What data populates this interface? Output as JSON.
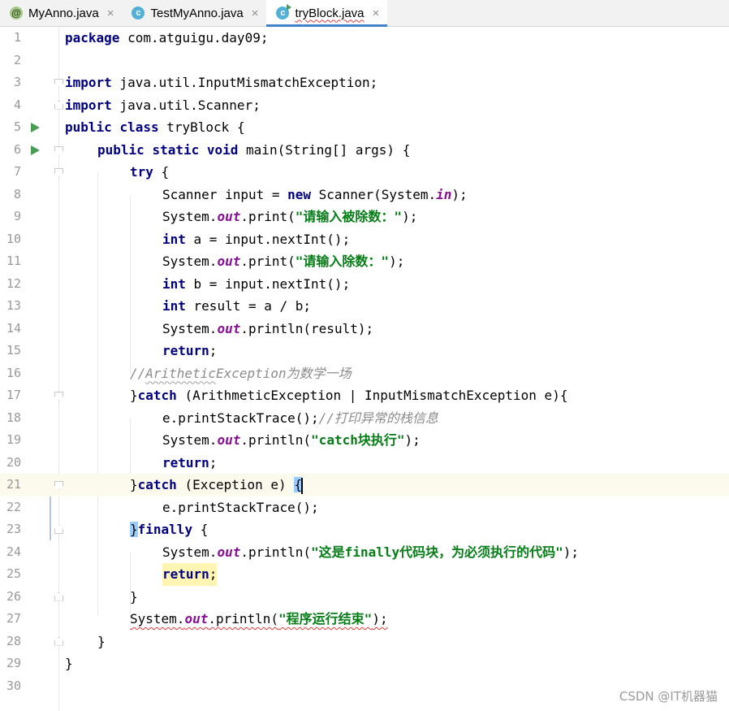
{
  "tabs": [
    {
      "label": "MyAnno.java",
      "icon": "annotation-file-icon",
      "close": "×"
    },
    {
      "label": "TestMyAnno.java",
      "icon": "class-file-icon",
      "close": "×"
    },
    {
      "label": "tryBlock.java",
      "icon": "runnable-class-icon",
      "close": "×"
    }
  ],
  "line_numbers": [
    "1",
    "2",
    "3",
    "4",
    "5",
    "6",
    "7",
    "8",
    "9",
    "10",
    "11",
    "12",
    "13",
    "14",
    "15",
    "16",
    "17",
    "18",
    "19",
    "20",
    "21",
    "22",
    "23",
    "24",
    "25",
    "26",
    "27",
    "28",
    "29",
    "30"
  ],
  "code": {
    "l1": {
      "kw": "package",
      "rest": " com.atguigu.day09;"
    },
    "l3": {
      "kw": "import",
      "rest": " java.util.InputMismatchException;"
    },
    "l4": {
      "kw": "import",
      "rest": " java.util.Scanner;"
    },
    "l5": {
      "kw1": "public",
      "kw2": "class",
      "rest": " tryBlock {"
    },
    "l6": {
      "kw1": "public",
      "kw2": "static",
      "kw3": "void",
      "rest": " main(String[] args) {"
    },
    "l7": {
      "kw": "try",
      "rest": " {"
    },
    "l8": {
      "a": "Scanner input = ",
      "kw": "new",
      "b": " Scanner(System.",
      "field": "in",
      "c": ");"
    },
    "l9": {
      "a": "System.",
      "field": "out",
      "b": ".print(",
      "str": "\"请输入被除数：\"",
      "c": ");"
    },
    "l10": {
      "kw": "int",
      "rest": " a = input.nextInt();"
    },
    "l11": {
      "a": "System.",
      "field": "out",
      "b": ".print(",
      "str": "\"请输入除数：\"",
      "c": ");"
    },
    "l12": {
      "kw": "int",
      "rest": " b = input.nextInt();"
    },
    "l13": {
      "kw": "int",
      "rest": " result = a / b;"
    },
    "l14": {
      "a": "System.",
      "field": "out",
      "b": ".println(result);"
    },
    "l15": {
      "kw": "return",
      "rest": ";"
    },
    "l16": {
      "cmt_a": "//",
      "cmt_b": "Arithetic",
      "cmt_c": "Exception为数学一场"
    },
    "l17": {
      "a": "}",
      "kw": "catch",
      "rest": " (ArithmeticException | InputMismatchException e){"
    },
    "l18": {
      "a": "e.printStackTrace();",
      "cmt": "//打印异常的栈信息"
    },
    "l19": {
      "a": "System.",
      "field": "out",
      "b": ".println(",
      "str": "\"catch块执行\"",
      "c": ");"
    },
    "l20": {
      "kw": "return",
      "rest": ";"
    },
    "l21": {
      "a": "}",
      "kw": "catch",
      "rest": " (Exception e) ",
      "brace": "{"
    },
    "l22": {
      "a": "e.printStackTrace();"
    },
    "l23": {
      "brace": "}",
      "kw": "finally",
      "rest": " {"
    },
    "l24": {
      "a": "System.",
      "field": "out",
      "b": ".println(",
      "str": "\"这是finally代码块，为必须执行的代码\"",
      "c": ");"
    },
    "l25": {
      "kw": "return",
      "rest": ";"
    },
    "l26": {
      "a": "}"
    },
    "l27": {
      "a": "System.",
      "field": "out",
      "b": ".println(",
      "str": "\"程序运行结束\"",
      "c": ");"
    },
    "l28": {
      "a": "}"
    },
    "l29": {
      "a": "}"
    }
  },
  "watermark": "CSDN @IT机器猫",
  "colors": {
    "keyword": "#000080",
    "string": "#067d17",
    "field": "#871094",
    "comment": "#8c8c8c",
    "accent": "#4083c9"
  }
}
